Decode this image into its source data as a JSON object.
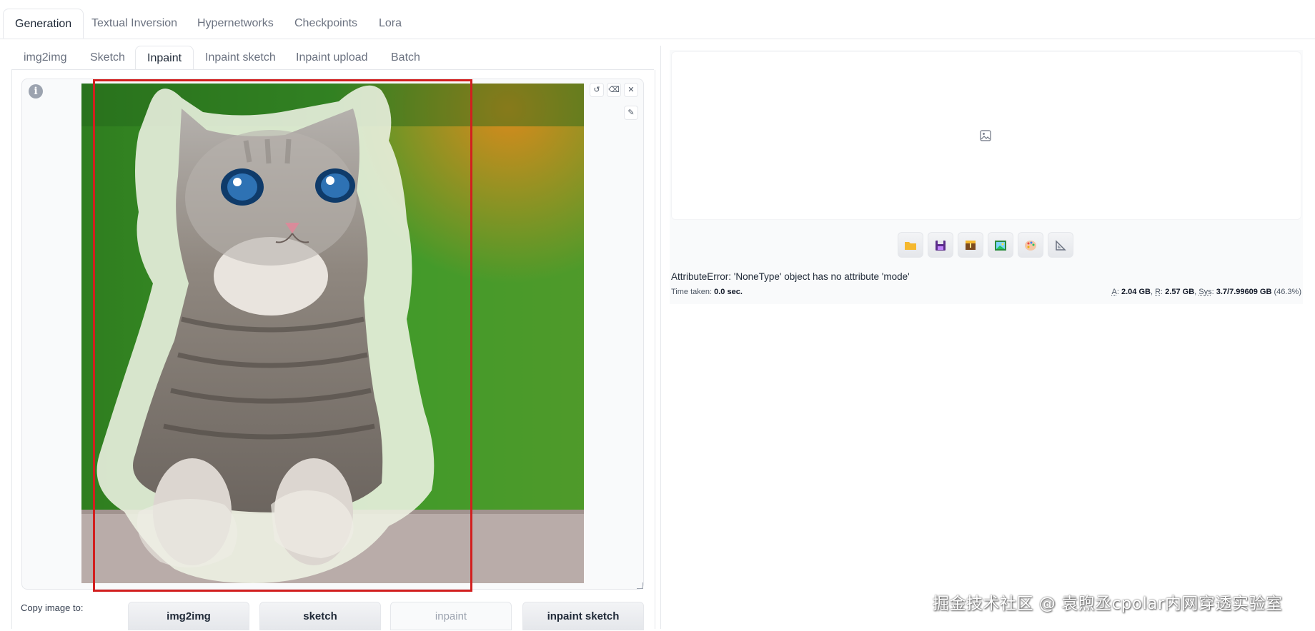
{
  "top_tabs": [
    "Generation",
    "Textual Inversion",
    "Hypernetworks",
    "Checkpoints",
    "Lora"
  ],
  "top_active": "Generation",
  "sub_tabs": [
    "img2img",
    "Sketch",
    "Inpaint",
    "Inpaint sketch",
    "Inpaint upload",
    "Batch"
  ],
  "sub_active": "Inpaint",
  "canvas": {
    "info_icon": "info-icon",
    "controls": [
      "undo-icon",
      "clear-icon",
      "close-icon",
      "brush-icon"
    ]
  },
  "copy": {
    "label": "Copy image to:",
    "buttons": [
      "img2img",
      "sketch",
      "inpaint",
      "inpaint sketch"
    ]
  },
  "output": {
    "tool_icons": [
      "folder-icon",
      "save-icon",
      "zip-icon",
      "send-image-icon",
      "send-inpaint-icon",
      "send-extras-icon"
    ],
    "error": "AttributeError: 'NoneType' object has no attribute 'mode'",
    "time_label": "Time taken:",
    "time_value": "0.0 sec.",
    "mem": {
      "a_label": "A",
      "a_value": "2.04 GB",
      "r_label": "R",
      "r_value": "2.57 GB",
      "sys_label": "Sys",
      "sys_value": "3.7/7.99609 GB",
      "pct": "(46.3%)"
    }
  },
  "watermark": "掘金技术社区 @ 袁煦丞cpolar内网穿透实验室",
  "colors": {
    "highlight_box": "#d21f1f",
    "mask": "#ffffff"
  }
}
